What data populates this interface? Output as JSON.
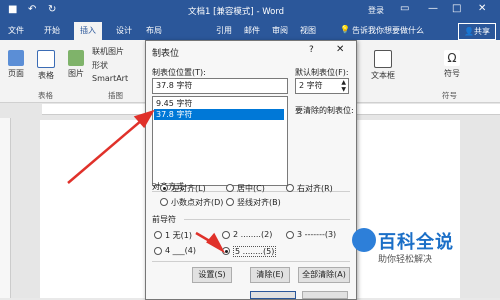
{
  "titlebar": {
    "document_title": "文档1 [兼容模式] - Word",
    "signin": "登录",
    "qa_save": "■",
    "qa_undo": "↶",
    "qa_redo": "↻"
  },
  "tabs": [
    {
      "label": "文件"
    },
    {
      "label": "开始"
    },
    {
      "label": "插入",
      "active": true
    },
    {
      "label": "设计"
    },
    {
      "label": "布局"
    },
    {
      "label": "引用"
    },
    {
      "label": "邮件"
    },
    {
      "label": "审阅"
    },
    {
      "label": "视图"
    }
  ],
  "tell_me": "告诉我你想要做什么",
  "share": "共享",
  "ribbon": {
    "page": "页面",
    "table": "表格",
    "table_group": "表格",
    "pictures": "图片",
    "online_pictures": "联机图片",
    "shapes": "形状",
    "smartart": "SmartArt",
    "illustrations_group": "插图",
    "textbox": "文本框",
    "symbols": "符号",
    "symbols_group": "符号"
  },
  "dialog": {
    "title": "制表位",
    "help": "?",
    "close": "✕",
    "tab_position_label": "制表位位置(T):",
    "tab_position_value": "37.8 字符",
    "tab_list": [
      {
        "text": "9.45 字符",
        "selected": false
      },
      {
        "text": "37.8 字符",
        "selected": true
      }
    ],
    "default_tab_label": "默认制表位(F):",
    "default_tab_value": "2 字符",
    "to_be_cleared_label": "要清除的制表位:",
    "alignment_label": "对齐方式",
    "alignment_options": [
      {
        "text": "左对齐(L)",
        "checked": true
      },
      {
        "text": "居中(C)",
        "checked": false
      },
      {
        "text": "右对齐(R)",
        "checked": false
      },
      {
        "text": "小数点对齐(D)",
        "checked": false
      },
      {
        "text": "竖线对齐(B)",
        "checked": false
      }
    ],
    "leader_label": "前导符",
    "leader_options": [
      {
        "text": "1 无(1)",
        "checked": false
      },
      {
        "text": "2 ........(2)",
        "checked": false
      },
      {
        "text": "3 -------(3)",
        "checked": false
      },
      {
        "text": "4 ___(4)",
        "checked": false
      },
      {
        "text": "5 ........(5)",
        "checked": true
      }
    ],
    "buttons": {
      "set": "设置(S)",
      "clear": "清除(E)",
      "clear_all": "全部清除(A)"
    }
  },
  "watermark": {
    "title": "百科全说",
    "subtitle": "助你轻松解决"
  },
  "colors": {
    "word_blue": "#2b579a",
    "selection": "#0078d7",
    "annotation_arrow": "#e0312a",
    "watermark_blue": "#1b6fc7"
  }
}
